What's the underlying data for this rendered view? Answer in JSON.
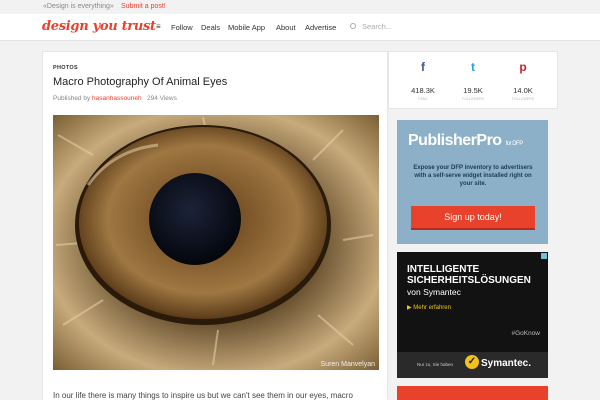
{
  "topbar": {
    "tagline": "«Design is everything»",
    "submit": "Submit a post!"
  },
  "header": {
    "logo": "design you trust",
    "nav": [
      "Follow",
      "Deals",
      "Mobile App",
      "About",
      "Advertise"
    ],
    "search_placeholder": "Search..."
  },
  "article": {
    "category": "PHOTOS",
    "title": "Macro Photography Of Animal Eyes",
    "published_prefix": "Published by",
    "author": "hasanhassouneh",
    "views": "294 Views",
    "photo_credit": "Suren Manvelyan",
    "body_start": "In our life there is many things to inspire us but we can't see them in our eyes, macro"
  },
  "social": [
    {
      "icon": "facebook-icon",
      "glyph": "f",
      "color": "#3b5998",
      "count": "418.3K",
      "sub": "FANS"
    },
    {
      "icon": "twitter-icon",
      "glyph": "t",
      "color": "#1da1f2",
      "count": "19.5K",
      "sub": "FOLLOWERS"
    },
    {
      "icon": "pinterest-icon",
      "glyph": "p",
      "color": "#cb2027",
      "count": "14.0K",
      "sub": "FOLLOWERS"
    }
  ],
  "ad_publisher": {
    "brand": "PublisherPro",
    "brand_suffix": "for DFP",
    "copy": "Expose your DFP inventory to advertisers with a self-serve widget installed right on your site.",
    "button": "Sign up today!"
  },
  "ad_symantec": {
    "headline_1": "INTELLIGENTE",
    "headline_2": "SICHERHEITSLÖSUNGEN",
    "by": "von Symantec",
    "more": "▶ Mehr erfahren",
    "hashtag": "#GoKnow",
    "note": "Nur zu, Sie haben",
    "brand": "Symantec."
  },
  "colors": {
    "accent": "#e8412c",
    "ad_blue": "#8bb0c8",
    "symantec_yellow": "#f0c21b"
  }
}
